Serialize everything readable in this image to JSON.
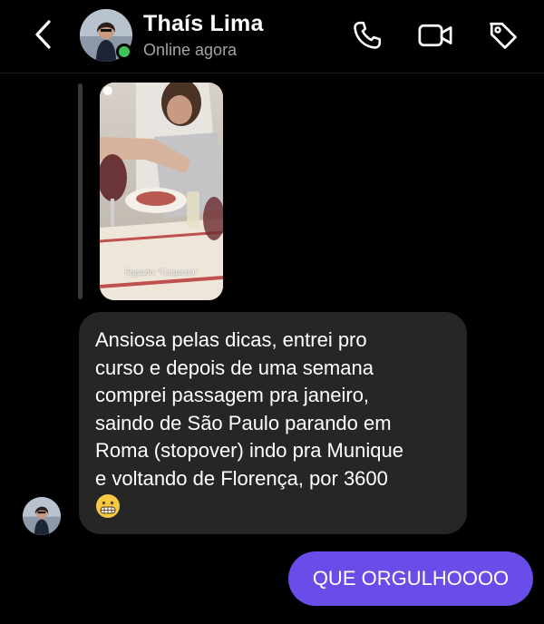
{
  "header": {
    "contact_name": "Thaís Lima",
    "status": "Online agora",
    "icons": [
      "back-chevron-icon",
      "phone-icon",
      "video-camera-icon",
      "tag-icon"
    ],
    "online_color": "#3cc35a"
  },
  "story_reply": {
    "caption": "Segundo: “Carpaccio”"
  },
  "messages": [
    {
      "direction": "incoming",
      "text": "Ansiosa pelas dicas, entrei pro\ncurso e depois de uma semana\ncomprei passagem pra janeiro,\nsaindo de São Paulo parando em\nRoma (stopover) indo pra Munique\ne voltando de Florença, por 3600",
      "emoji": "grimacing-face-emoji"
    },
    {
      "direction": "outgoing",
      "text": "QUE ORGULHOOOO",
      "color": "#6a4de8"
    }
  ]
}
